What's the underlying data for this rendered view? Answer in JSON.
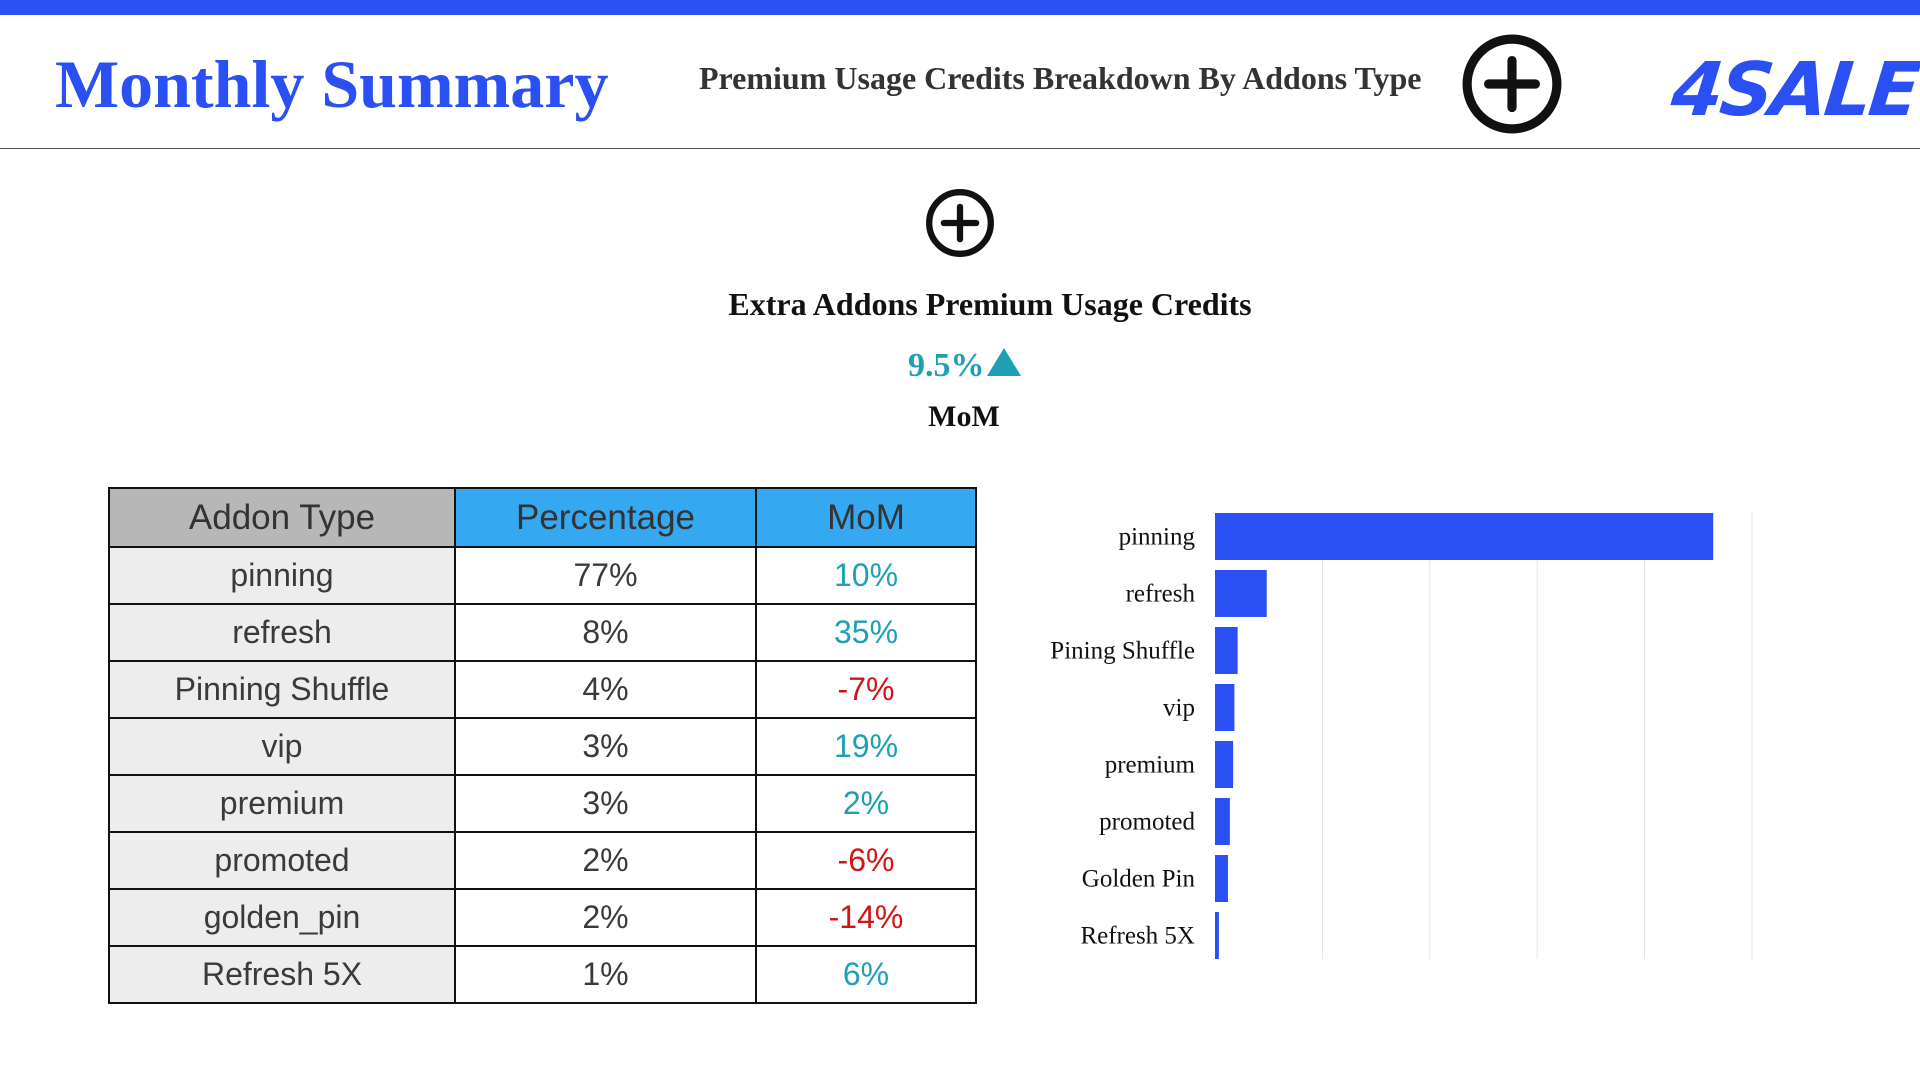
{
  "header": {
    "title": "Monthly Summary",
    "subtitle": "Premium Usage Credits Breakdown By Addons Type",
    "logo_text": "4SALE",
    "plus_icon": "plus-circle-icon"
  },
  "colors": {
    "brand_blue": "#2a4ff2",
    "positive": "#1f9fb5",
    "negative": "#d11414",
    "header_gray": "#b7b7b7",
    "header_blue": "#34a8f0"
  },
  "kpi": {
    "icon": "plus-circle-icon",
    "title": "Extra Addons Premium Usage Credits",
    "value": "9.5%",
    "trend": "up",
    "label": "MoM"
  },
  "table": {
    "headers": [
      "Addon Type",
      "Percentage",
      "MoM"
    ],
    "rows": [
      {
        "type": "pinning",
        "percentage": "77%",
        "mom": "10%",
        "sign": "pos"
      },
      {
        "type": "refresh",
        "percentage": "8%",
        "mom": "35%",
        "sign": "pos"
      },
      {
        "type": "Pinning Shuffle",
        "percentage": "4%",
        "mom": "-7%",
        "sign": "neg"
      },
      {
        "type": "vip",
        "percentage": "3%",
        "mom": "19%",
        "sign": "pos"
      },
      {
        "type": "premium",
        "percentage": "3%",
        "mom": "2%",
        "sign": "pos"
      },
      {
        "type": "promoted",
        "percentage": "2%",
        "mom": "-6%",
        "sign": "neg"
      },
      {
        "type": "golden_pin",
        "percentage": "2%",
        "mom": "-14%",
        "sign": "neg"
      },
      {
        "type": "Refresh 5X",
        "percentage": "1%",
        "mom": "6%",
        "sign": "pos"
      }
    ]
  },
  "chart_data": {
    "type": "bar",
    "orientation": "horizontal",
    "categories": [
      "pinning",
      "refresh",
      "Pining Shuffle",
      "vip",
      "premium",
      "promoted",
      "Golden Pin",
      "Refresh 5X"
    ],
    "values": [
      77,
      8,
      3.5,
      3,
      2.8,
      2.3,
      2,
      0.6
    ],
    "xlim": [
      0,
      83
    ],
    "grid": true,
    "bar_color": "#2a4ff2",
    "title": "",
    "xlabel": "",
    "ylabel": ""
  }
}
